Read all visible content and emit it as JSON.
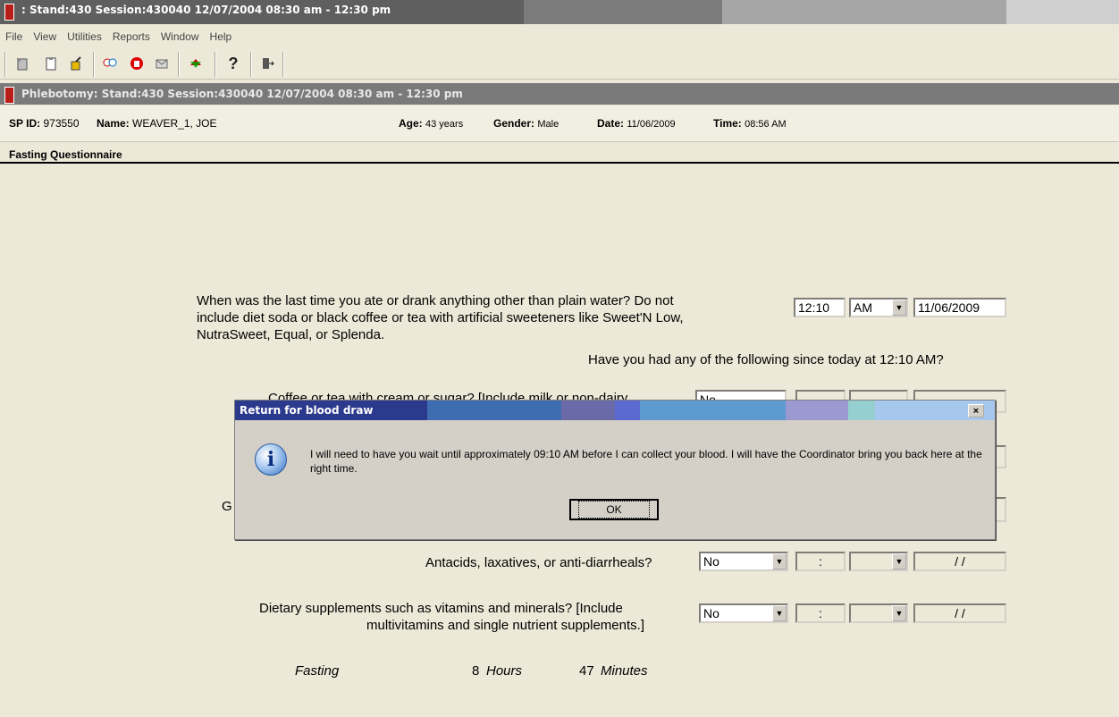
{
  "window": {
    "title": ": Stand:430 Session:430040 12/07/2004 08:30 am - 12:30 pm"
  },
  "menu": [
    {
      "label": "File"
    },
    {
      "label": "View"
    },
    {
      "label": "Utilities"
    },
    {
      "label": "Reports"
    },
    {
      "label": "Window"
    },
    {
      "label": "Help"
    }
  ],
  "toolbar": {
    "icons": [
      "new-icon",
      "clipboard-icon",
      "pipette-icon",
      "search-people-icon",
      "stop-hand-icon",
      "envelope-icon",
      "exchange-icon",
      "help-icon",
      "exit-icon"
    ]
  },
  "subwindow": {
    "title": "Phlebotomy: Stand:430 Session:430040 12/07/2004 08:30 am - 12:30 pm"
  },
  "sp": {
    "id_label": "SP ID:",
    "id_value": "973550",
    "name_label": "Name:",
    "name_value": "WEAVER_1, JOE",
    "age_label": "Age:",
    "age_value": "43 years",
    "gender_label": "Gender:",
    "gender_value": "Male",
    "date_label": "Date:",
    "date_value": "11/06/2009",
    "time_label": "Time:",
    "time_value": "08:56 AM"
  },
  "section": {
    "title": "Fasting Questionnaire"
  },
  "question": {
    "line1": "When was the last time you ate or drank anything other than plain water?  Do not",
    "line2": "include diet soda or black coffee or tea with artificial sweeteners like Sweet'N Low,",
    "line3": "NutraSweet, Equal, or Splenda.",
    "time_value": "12:10",
    "ampm_value": "AM",
    "date_value": "11/06/2009",
    "since_text": "Have you had any of the following since today at 12:10 AM?"
  },
  "rows": {
    "coffee": {
      "label": "Coffee or tea with cream or sugar? [Include milk or non-dairy",
      "value": "No"
    },
    "hidden_label_fragment": "G",
    "antacids": {
      "label": "Antacids, laxatives, or anti-diarrheals?",
      "value": "No",
      "time_placeholder": ":",
      "date_placeholder": "/ /"
    },
    "supplements": {
      "label_line1": "Dietary supplements such as vitamins and minerals? [Include",
      "label_line2": "multivitamins and single nutrient supplements.]",
      "value": "No",
      "time_placeholder": ":",
      "date_placeholder": "/ /"
    }
  },
  "fasting": {
    "label": "Fasting",
    "hours_value": "8",
    "hours_label": "Hours",
    "minutes_value": "47",
    "minutes_label": "Minutes"
  },
  "dialog": {
    "title": "Return for blood draw",
    "close_label": "×",
    "message": "I will need to have you wait until approximately 09:10 AM before I can collect your blood. I will have the Coordinator bring you back here at the right time.",
    "ok_label": "OK",
    "icon": "info-icon"
  },
  "colors": {
    "titlebar_active": "#7a7a7a",
    "dialog_title_start": "#2b3a8c",
    "dialog_title_end": "#a6c8ee"
  }
}
